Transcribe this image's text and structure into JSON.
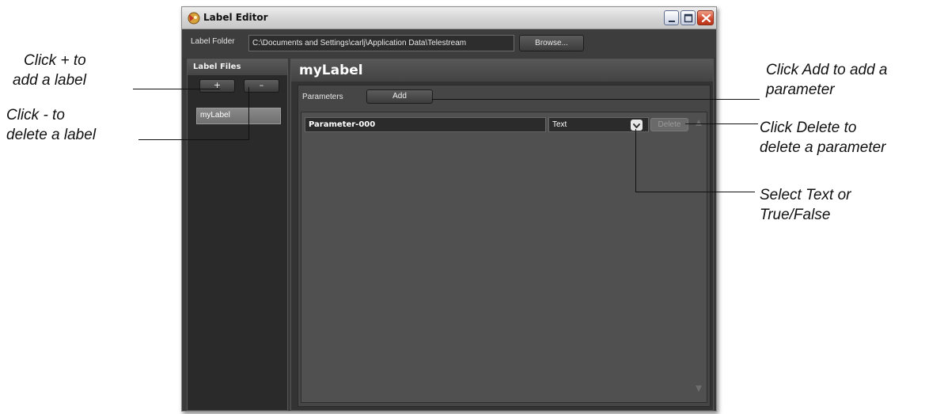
{
  "window": {
    "title": "Label Editor",
    "icon": "label-editor-app-icon",
    "controls": [
      "minimize-icon",
      "maximize-icon",
      "close-icon"
    ]
  },
  "folder": {
    "label": "Label Folder",
    "path": "C:\\Documents and Settings\\carlj\\Application Data\\Telestream",
    "browse_label": "Browse..."
  },
  "label_files": {
    "header": "Label Files",
    "add_label": "+",
    "remove_label": "–",
    "items": [
      "myLabel"
    ]
  },
  "editor": {
    "label_name": "myLabel",
    "parameters_label": "Parameters",
    "add_label": "Add",
    "rows": [
      {
        "name": "Parameter-000",
        "type": "Text",
        "delete_label": "Delete"
      }
    ]
  },
  "callouts": {
    "add_label": [
      "Click + to",
      "add a label"
    ],
    "delete_label": [
      "Click - to",
      "delete a label"
    ],
    "add_param": [
      "Click Add to add a",
      "parameter"
    ],
    "delete_param": [
      "Click Delete to",
      "delete a parameter"
    ],
    "select_type": [
      "Select Text or",
      "True/False"
    ]
  }
}
